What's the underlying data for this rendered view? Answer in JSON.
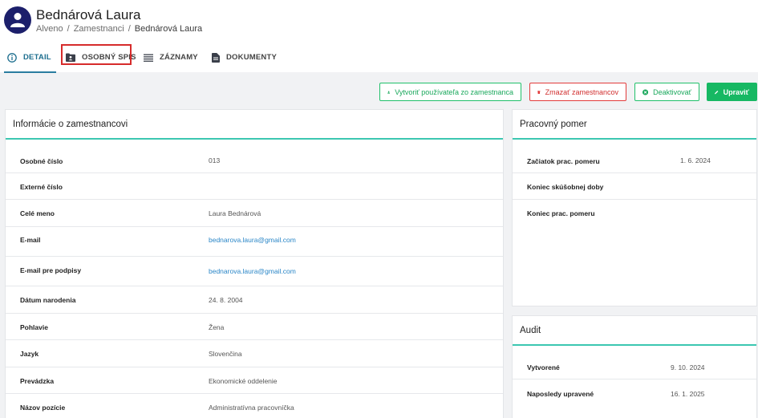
{
  "header": {
    "title": "Bednárová Laura",
    "breadcrumb": [
      "Alveno",
      "Zamestnanci",
      "Bednárová Laura"
    ]
  },
  "tabs": [
    {
      "label": "DETAIL",
      "icon": "info-icon",
      "active": true
    },
    {
      "label": "OSOBNÝ SPIS",
      "icon": "folder-user-icon",
      "active": false,
      "highlighted": true
    },
    {
      "label": "ZÁZNAMY",
      "icon": "list-icon",
      "active": false
    },
    {
      "label": "DOKUMENTY",
      "icon": "document-icon",
      "active": false
    }
  ],
  "actions": {
    "create_user": "Vytvoriť používateľa zo zamestnanca",
    "delete": "Zmazať zamestnancov",
    "deactivate": "Deaktivovať",
    "edit": "Upraviť"
  },
  "employee_info": {
    "title": "Informácie o zamestnancovi",
    "rows": [
      {
        "label": "Osobné číslo",
        "value": "013"
      },
      {
        "label": "Externé číslo",
        "value": ""
      },
      {
        "label": "Celé meno",
        "value": "Laura Bednárová"
      },
      {
        "label": "E-mail",
        "value": "bednarova.laura@gmail.com"
      },
      {
        "label": "E-mail pre podpisy",
        "value": "bednarova.laura@gmail.com"
      },
      {
        "label": "Dátum narodenia",
        "value": "24. 8. 2004"
      },
      {
        "label": "Pohlavie",
        "value": "Žena"
      },
      {
        "label": "Jazyk",
        "value": "Slovenčina"
      },
      {
        "label": "Prevádzka",
        "value": "Ekonomické oddelenie"
      },
      {
        "label": "Názov pozície",
        "value": "Administratívna pracovníčka"
      }
    ]
  },
  "employment": {
    "title": "Pracovný pomer",
    "rows": [
      {
        "label": "Začiatok prac. pomeru",
        "value": "1. 6. 2024"
      },
      {
        "label": "Koniec skúšobnej doby",
        "value": ""
      },
      {
        "label": "Koniec prac. pomeru",
        "value": ""
      }
    ]
  },
  "audit": {
    "title": "Audit",
    "rows": [
      {
        "label": "Vytvorené",
        "value": "9. 10. 2024"
      },
      {
        "label": "Naposledy upravené",
        "value": "16. 1. 2025"
      }
    ]
  },
  "colors": {
    "primary": "#1e6f8f",
    "accent": "#3cc7b1",
    "success": "#17b863",
    "danger": "#e23b3b",
    "avatar": "#1c1f6b",
    "link": "#2a86c7"
  }
}
